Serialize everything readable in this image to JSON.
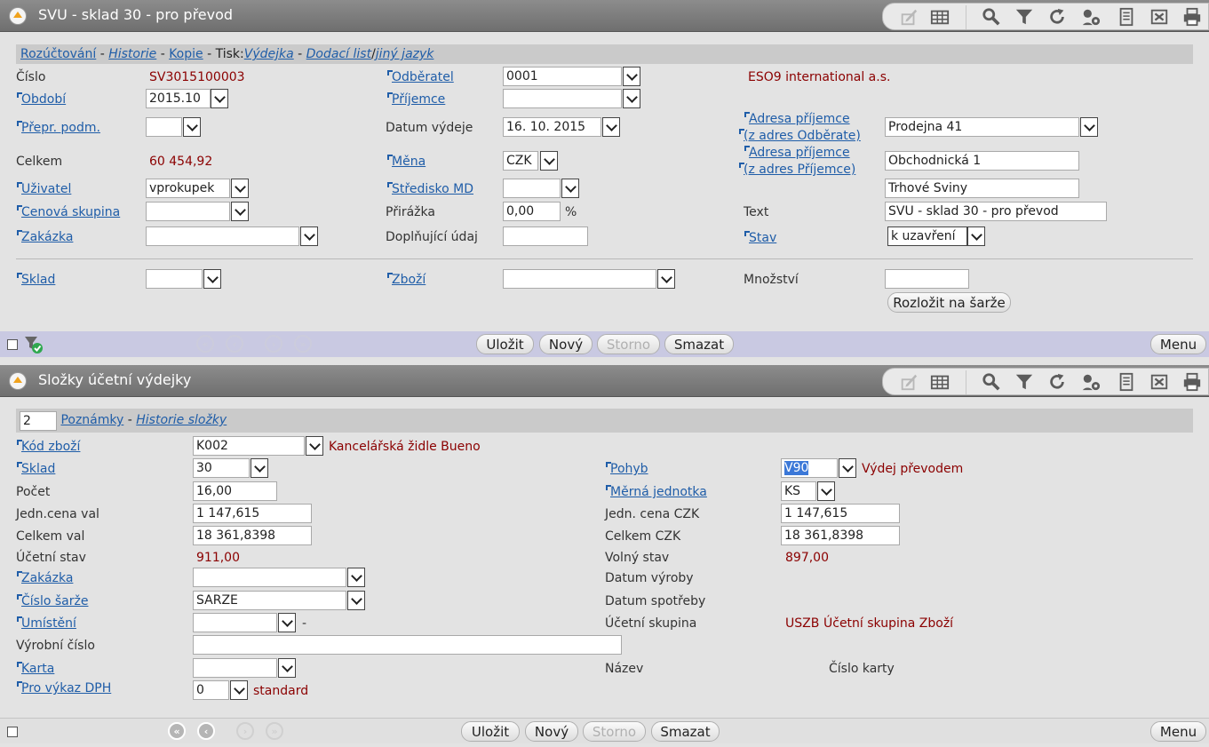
{
  "top": {
    "title": "SVU - sklad 30 - pro převod",
    "links": {
      "rozuctovani": "Rozúčtování",
      "historie": "Historie",
      "kopie": "Kopie",
      "tisk": "Tisk:",
      "vydejka": "Výdejka",
      "dodaci_list": "Dodací list",
      "jiny_jazyk": "jiný jazyk"
    },
    "fields": {
      "cislo_label": "Číslo",
      "cislo_value": "SV3015100003",
      "obdobi_label": "Období",
      "obdobi_value": "2015.10",
      "prepr_label": "Přepr. podm.",
      "prepr_value": "",
      "celkem_label": "Celkem",
      "celkem_value": "60 454,92",
      "uzivatel_label": "Uživatel",
      "uzivatel_value": "vprokupek",
      "cenova_label": "Cenová skupina",
      "cenova_value": "",
      "zakazka_label": "Zakázka",
      "zakazka_value": "",
      "odberatel_label": "Odběratel",
      "odberatel_value": "0001",
      "odberatel_name": "ESO9 international a.s.",
      "prijemce_label": "Příjemce",
      "prijemce_value": "",
      "datum_label": "Datum výdeje",
      "datum_value": "16. 10. 2015",
      "mena_label": "Měna",
      "mena_value": "CZK",
      "stredisko_label": "Středisko MD",
      "stredisko_value": "",
      "prirazka_label": "Přirážka",
      "prirazka_value": "0,00",
      "prirazka_unit": "%",
      "doplnujici_label": "Doplňující údaj",
      "doplnujici_value": "",
      "adresa1_label_a": "Adresa příjemce",
      "adresa1_label_b": "(z adres Odběrate)",
      "adresa1_value": "Prodejna 41",
      "adresa2_label_a": "Adresa příjemce",
      "adresa2_label_b": "(z adres Příjemce)",
      "adresa2_value": "Obchodnická 1",
      "adresa2_city": "Trhové Sviny",
      "text_label": "Text",
      "text_value": "SVU - sklad 30 - pro převod",
      "stav_label": "Stav",
      "stav_value": "k uzavření",
      "sklad_label": "Sklad",
      "sklad_value": "",
      "zbozi_label": "Zboží",
      "zbozi_value": "",
      "mnozstvi_label": "Množství",
      "mnozstvi_value": "",
      "rozlozit_button": "Rozložit na šarže"
    },
    "actions": {
      "ulozit": "Uložit",
      "novy": "Nový",
      "storno": "Storno",
      "smazat": "Smazat",
      "menu": "Menu"
    }
  },
  "bottom": {
    "title": "Složky účetní výdejky",
    "index_value": "2",
    "links": {
      "poznamky": "Poznámky",
      "historie_slozky": "Historie složky"
    },
    "fields": {
      "kod_label": "Kód zboží",
      "kod_value": "K002",
      "kod_name": "Kancelářská židle Bueno",
      "sklad_label": "Sklad",
      "sklad_value": "30",
      "pocet_label": "Počet",
      "pocet_value": "16,00",
      "jcena_val_label": "Jedn.cena val",
      "jcena_val_value": "1 147,615",
      "celkem_val_label": "Celkem val",
      "celkem_val_value": "18 361,8398",
      "ucetni_stav_label": "Účetní stav",
      "ucetni_stav_value": "911,00",
      "zakazka_label": "Zakázka",
      "zakazka_value": "",
      "sarze_label": "Číslo šarže",
      "sarze_value": "SARZE",
      "umisteni_label": "Umístění",
      "umisteni_value": "",
      "umisteni_suffix": "-",
      "vyrobni_label": "Výrobní číslo",
      "vyrobni_value": "",
      "karta_label": "Karta",
      "karta_value": "",
      "dph_label": "Pro výkaz DPH",
      "dph_value": "0",
      "dph_text": "standard",
      "pohyb_label": "Pohyb",
      "pohyb_value": "V90",
      "pohyb_name": "Výdej převodem",
      "mj_label": "Měrná jednotka",
      "mj_value": "KS",
      "jcena_czk_label": "Jedn. cena CZK",
      "jcena_czk_value": "1 147,615",
      "celkem_czk_label": "Celkem CZK",
      "celkem_czk_value": "18 361,8398",
      "volny_label": "Volný stav",
      "volny_value": "897,00",
      "datum_vyroby_label": "Datum výroby",
      "datum_spotreby_label": "Datum spotřeby",
      "ucetni_skupina_label": "Účetní skupina",
      "ucetni_skupina_code": "USZB",
      "ucetni_skupina_name": "Účetní skupina Zboží",
      "nazev_label": "Název",
      "cislo_karty_label": "Číslo karty"
    },
    "actions": {
      "ulozit": "Uložit",
      "novy": "Nový",
      "storno": "Storno",
      "smazat": "Smazat",
      "menu": "Menu"
    }
  },
  "icons": [
    "edit-icon",
    "table-icon",
    "search-icon",
    "filter-icon",
    "refresh-icon",
    "settings-icon",
    "document-icon",
    "excel-icon",
    "print-icon"
  ]
}
